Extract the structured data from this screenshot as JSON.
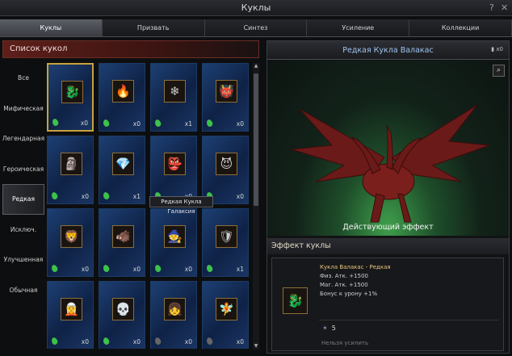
{
  "window": {
    "title": "Куклы",
    "help": "?",
    "close": "✕"
  },
  "tabs": [
    {
      "label": "Куклы",
      "active": true
    },
    {
      "label": "Призвать",
      "active": false
    },
    {
      "label": "Синтез",
      "active": false
    },
    {
      "label": "Усиление",
      "active": false
    },
    {
      "label": "Коллекции",
      "active": false
    }
  ],
  "left": {
    "header": "Список кукол",
    "categories": [
      "Все",
      "Мифическая",
      "Легендарная",
      "Героическая",
      "Редкая",
      "Исключ.",
      "Улучшенная",
      "Обычная"
    ],
    "active_category": "Редкая"
  },
  "grid": {
    "tooltip": "Редкая Кукла Галаксия",
    "selected_index": 0,
    "cards": [
      {
        "icon": "red-dragon-doll-icon",
        "glyph": "🐉",
        "count": "x0",
        "gem": "green"
      },
      {
        "icon": "fire-spirit-doll-icon",
        "glyph": "🔥",
        "count": "x0",
        "gem": "green"
      },
      {
        "icon": "ice-golem-doll-icon",
        "glyph": "❄",
        "count": "x1",
        "gem": "green"
      },
      {
        "icon": "green-beast-doll-icon",
        "glyph": "👹",
        "count": "x0",
        "gem": "green"
      },
      {
        "icon": "stone-golem-doll-icon",
        "glyph": "🗿",
        "count": "x0",
        "gem": "green"
      },
      {
        "icon": "crystal-spirit-doll-icon",
        "glyph": "💎",
        "count": "x1",
        "gem": "green"
      },
      {
        "icon": "fire-knight-doll-icon",
        "glyph": "👺",
        "count": "x0",
        "gem": "green"
      },
      {
        "icon": "red-demon-doll-icon",
        "glyph": "😈",
        "count": "x0",
        "gem": "green"
      },
      {
        "icon": "lion-doll-icon",
        "glyph": "🦁",
        "count": "x0",
        "gem": "green"
      },
      {
        "icon": "horned-warrior-doll-icon",
        "glyph": "🐗",
        "count": "x0",
        "gem": "green"
      },
      {
        "icon": "white-mage-doll-icon",
        "glyph": "🧙",
        "count": "x0",
        "gem": "green"
      },
      {
        "icon": "armored-knight-doll-icon",
        "glyph": "🛡",
        "count": "x1",
        "gem": "green"
      },
      {
        "icon": "forest-warrior-doll-icon",
        "glyph": "🧝",
        "count": "x0",
        "gem": "green"
      },
      {
        "icon": "skull-warrior-doll-icon",
        "glyph": "💀",
        "count": "x0",
        "gem": "green"
      },
      {
        "icon": "white-hair-girl-doll-icon",
        "glyph": "👧",
        "count": "x0",
        "gem": "grey"
      },
      {
        "icon": "silver-elf-doll-icon",
        "glyph": "🧚",
        "count": "x0",
        "gem": "grey"
      }
    ]
  },
  "right": {
    "title": "Редкая Кукла Валакас",
    "owned_count": "x0",
    "zoom_icon": "magnifier-icon",
    "effect_button": "Действующий эффект",
    "effect_header": "Эффект куклы",
    "effect": {
      "name": "Кукла Валакас - Редкая",
      "lines": [
        "Физ. Атк. +1500",
        "Маг. Атк. +1500",
        "Бонус к урону +1%"
      ],
      "level": "5",
      "note": "Нельзя усилить"
    }
  },
  "colors": {
    "accent_gold": "#c8a23c",
    "card_blue": "#1d3f73",
    "stage_green": "#3f9f4c",
    "title_blue": "#9ec3ef"
  }
}
